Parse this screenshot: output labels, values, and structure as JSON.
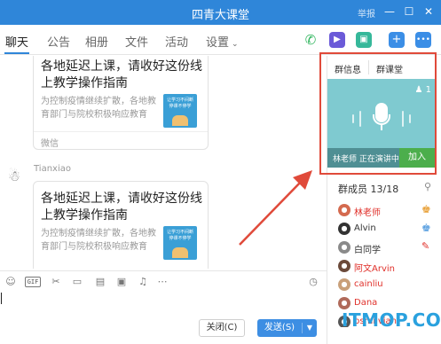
{
  "window": {
    "title": "四青大课堂",
    "report": "举报",
    "minimize": "—",
    "maximize": "☐",
    "close": "✕"
  },
  "tabs": [
    "聊天",
    "公告",
    "相册",
    "文件",
    "活动",
    "设置"
  ],
  "tab_settings_chevron": "⌄",
  "messages": [
    {
      "title": "各地延迟上课，请收好这份线上教学操作指南",
      "desc": "为控制疫情继续扩散，各地教育部门与院校积极响应教育",
      "thumb_text": "让学习不间断停课不停学",
      "source": "微信"
    },
    {
      "sender": "Tianxiao",
      "title": "各地延迟上课，请收好这份线上教学操作指南",
      "desc": "为控制疫情继续扩散，各地教育部门与院校积极响应教育",
      "thumb_text": "让学习不间断停课不停学"
    }
  ],
  "send_controls": {
    "close_label": "关闭(C)",
    "send_label": "发送(S)",
    "send_dropdown": "▼"
  },
  "right_panel": {
    "tab_info": "群信息",
    "tab_classroom": "群课堂",
    "listener_count": "1",
    "live_text": "林老师 正在演讲中",
    "join_label": "加入",
    "members_title": "群成员 13/18",
    "members": [
      {
        "name": "林老师",
        "color": "#e0302a",
        "role": "owner"
      },
      {
        "name": "Alvin",
        "color": "#333333",
        "role": "admin"
      },
      {
        "name": "白同学",
        "color": "#333333",
        "role": "edit"
      },
      {
        "name": "阿文Arvin",
        "color": "#e0302a",
        "role": ""
      },
      {
        "name": "cainliu",
        "color": "#e0302a",
        "role": ""
      },
      {
        "name": "Dana",
        "color": "#e0302a",
        "role": ""
      },
      {
        "name": "bsmilvian",
        "color": "#e0302a",
        "role": ""
      }
    ]
  },
  "watermark": "ITMOP.COM",
  "colors": {
    "title_bar": "#2f86d9",
    "highlight": "#e04a3a",
    "live_box": "#7fcad0",
    "join_button": "#4cae4c"
  }
}
